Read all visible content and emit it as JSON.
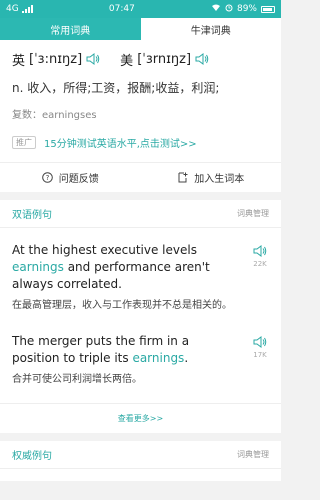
{
  "status": {
    "network": "4G",
    "time": "07:47",
    "battery": "89%"
  },
  "tabs": [
    "常用词典",
    "牛津词典"
  ],
  "word": {
    "uk_label": "英",
    "uk_phonetic": "[ˈɜ:nɪŋz]",
    "us_label": "美",
    "us_phonetic": "[ˈɜrnɪŋz]",
    "definition": "n. 收入，所得;工资，报酬;收益，利润;",
    "plural": "复数：earningses"
  },
  "ad": {
    "badge": "推广",
    "text": "15分钟测试英语水平,点击测试>>"
  },
  "actions": {
    "feedback": "问题反馈",
    "add_word": "加入生词本"
  },
  "bilingual": {
    "title": "双语例句",
    "manage": "词典管理",
    "examples": [
      {
        "en_before": "At the highest executive levels ",
        "highlight": "earnings",
        "en_after": " and performance aren't always correlated.",
        "zh": "在最高管理层，收入与工作表现并不总是相关的。",
        "count": "22K"
      },
      {
        "en_before": "The merger puts the firm in a position to triple its ",
        "highlight": "earnings",
        "en_after": ".",
        "zh": "合并可使公司利润增长两倍。",
        "count": "17K"
      }
    ],
    "more": "查看更多>>"
  },
  "authority": {
    "title": "权威例句",
    "manage": "词典管理"
  },
  "colors": {
    "accent": "#2aa9a4",
    "status_bar": "#29b6b0"
  }
}
